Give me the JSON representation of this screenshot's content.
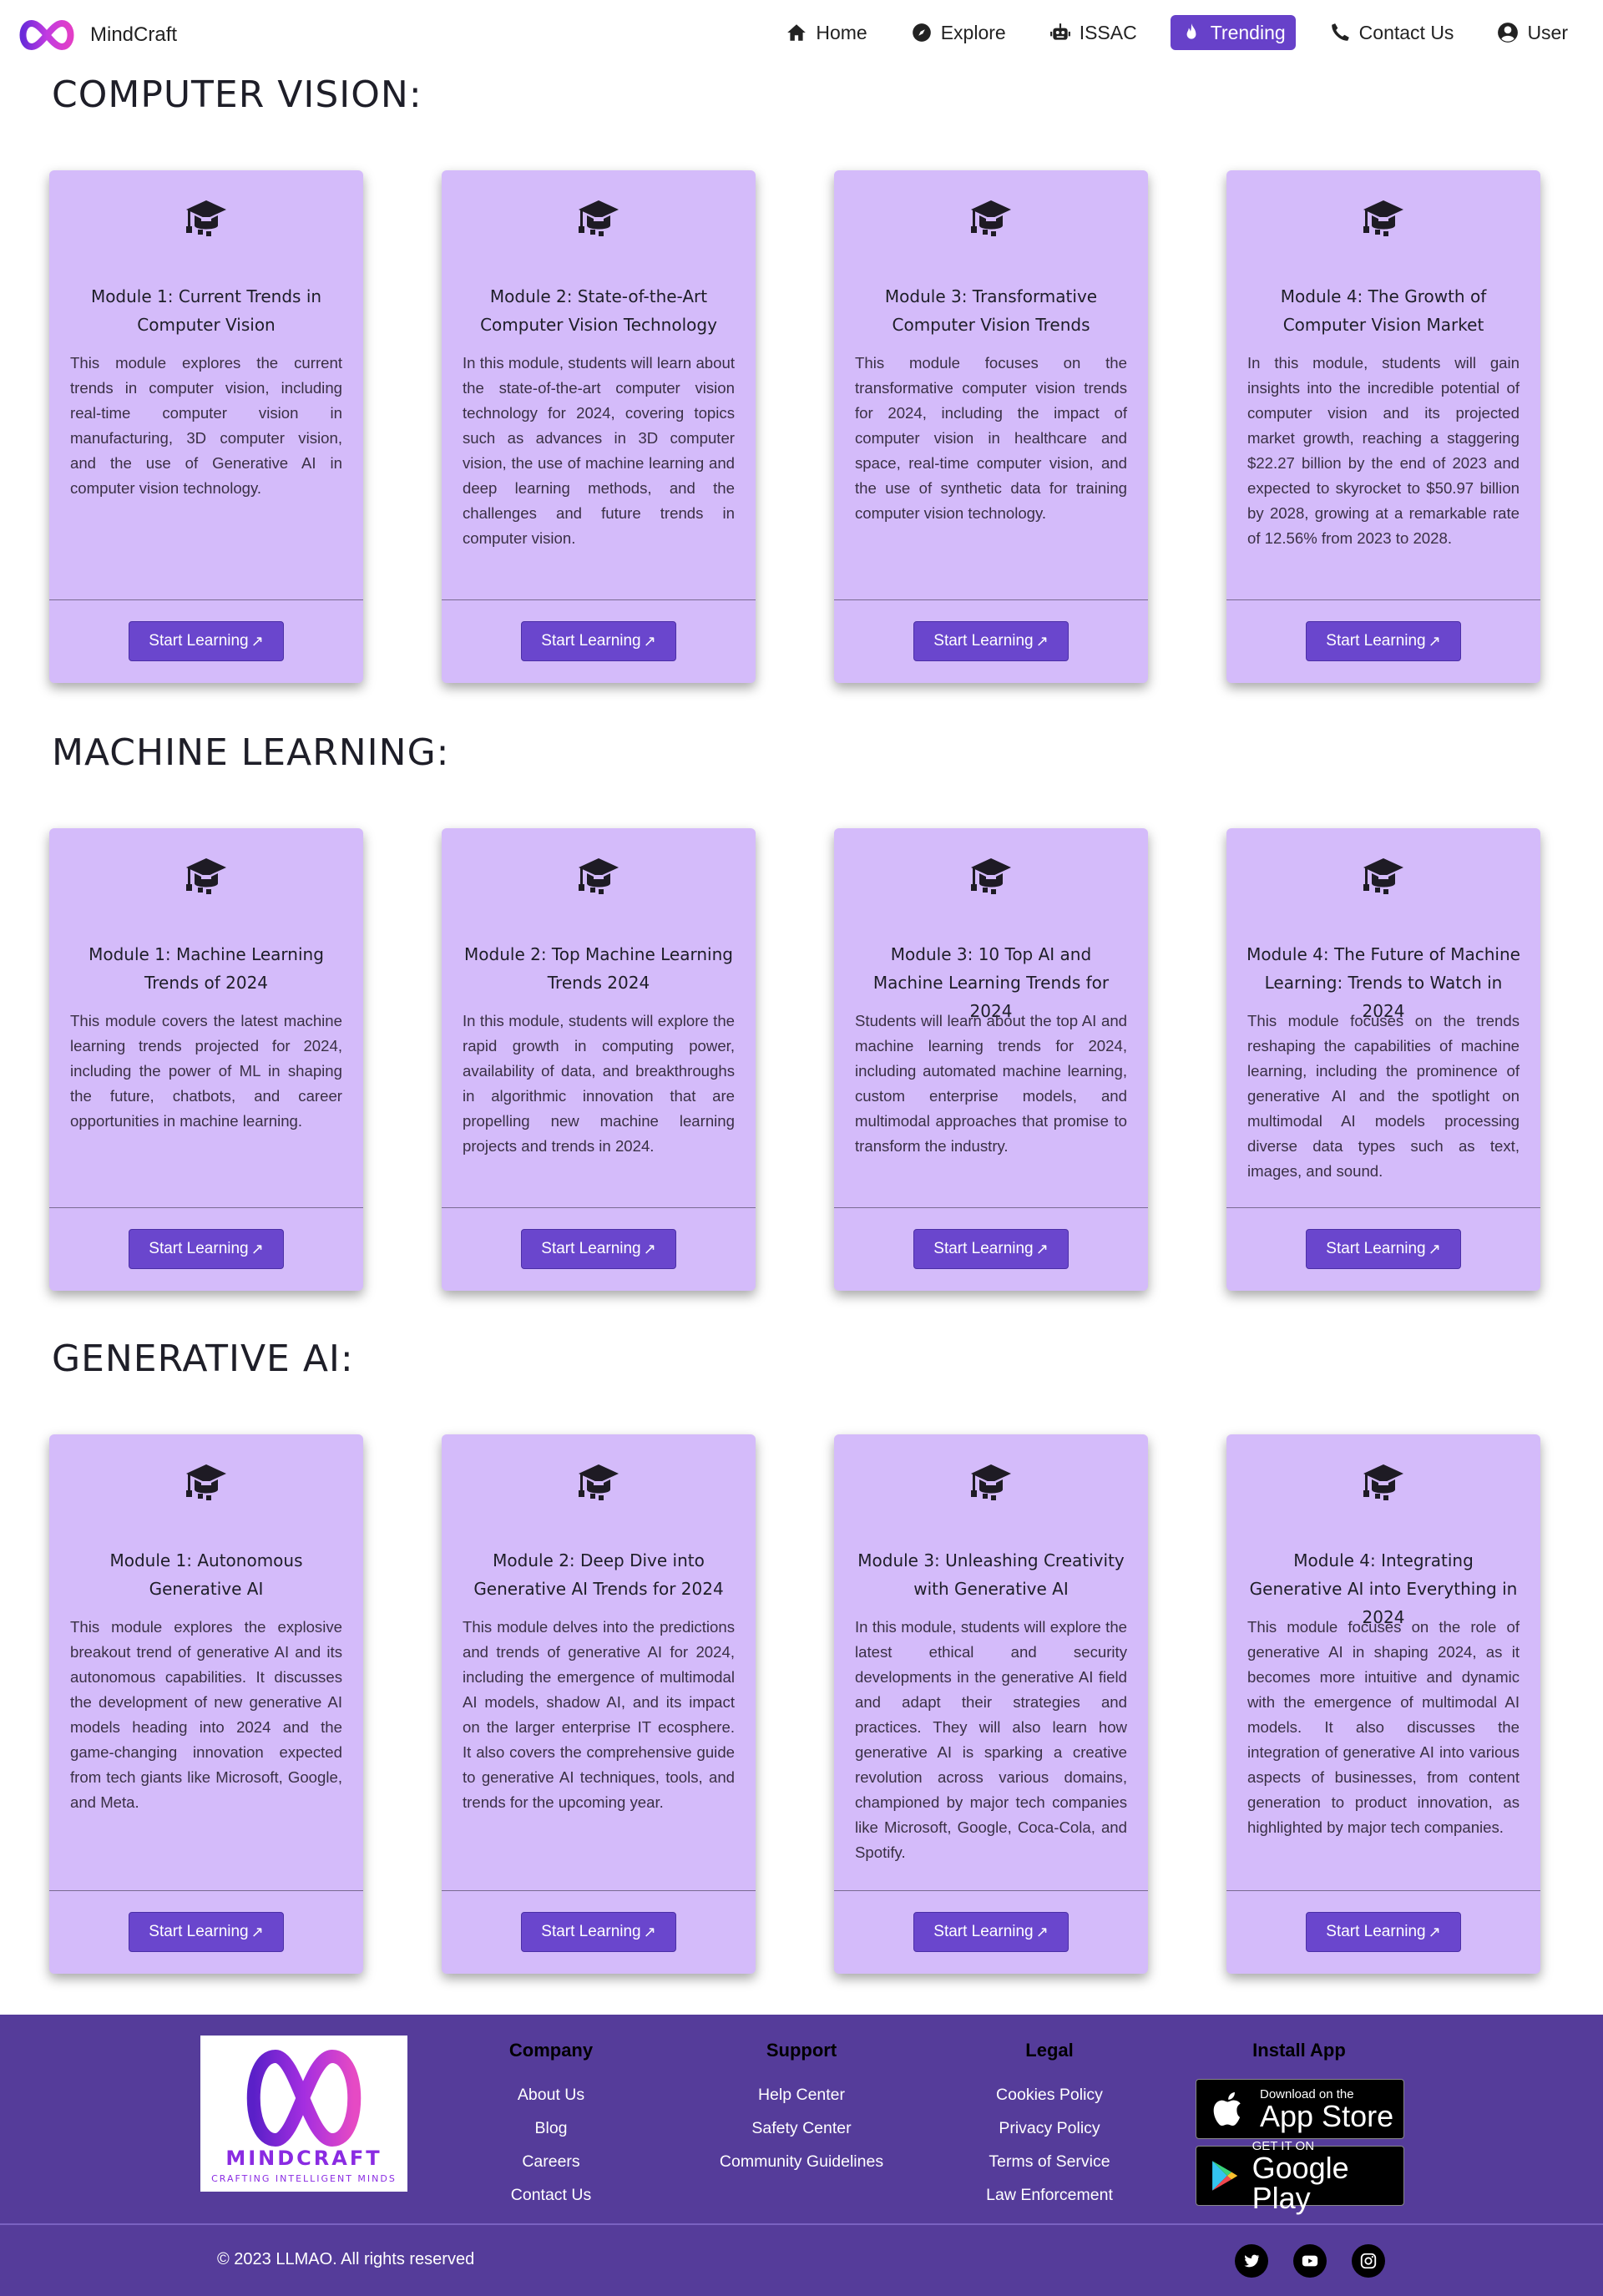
{
  "brand": {
    "name": "MindCraft",
    "logo_icon": "infinity-logo"
  },
  "nav": {
    "items": [
      {
        "label": "Home",
        "icon": "home-icon"
      },
      {
        "label": "Explore",
        "icon": "compass-icon"
      },
      {
        "label": "ISSAC",
        "icon": "robot-icon"
      },
      {
        "label": "Trending",
        "icon": "fire-icon",
        "active": true
      },
      {
        "label": "Contact Us",
        "icon": "phone-icon"
      },
      {
        "label": "User",
        "icon": "user-icon"
      }
    ]
  },
  "button_label": "Start Learning",
  "sections": [
    {
      "title": "COMPUTER VISION:",
      "cards": [
        {
          "title": "Module 1: Current Trends in Computer Vision",
          "text": "This module explores the current trends in computer vision, including real-time computer vision in manufacturing, 3D computer vision, and the use of Generative AI in computer vision technology."
        },
        {
          "title": "Module 2: State-of-the-Art Computer Vision Technology",
          "text": "In this module, students will learn about the state-of-the-art computer vision technology for 2024, covering topics such as advances in 3D computer vision, the use of machine learning and deep learning methods, and the challenges and future trends in computer vision."
        },
        {
          "title": "Module 3: Transformative Computer Vision Trends",
          "text": "This module focuses on the transformative computer vision trends for 2024, including the impact of computer vision in healthcare and space, real-time computer vision, and the use of synthetic data for training computer vision technology."
        },
        {
          "title": "Module 4: The Growth of Computer Vision Market",
          "text": "In this module, students will gain insights into the incredible potential of computer vision and its projected market growth, reaching a staggering $22.27 billion by the end of 2023 and expected to skyrocket to $50.97 billion by 2028, growing at a remarkable rate of 12.56% from 2023 to 2028."
        }
      ]
    },
    {
      "title": "MACHINE LEARNING:",
      "cards": [
        {
          "title": "Module 1: Machine Learning Trends of 2024",
          "text": "This module covers the latest machine learning trends projected for 2024, including the power of ML in shaping the future, chatbots, and career opportunities in machine learning."
        },
        {
          "title": "Module 2: Top Machine Learning Trends 2024",
          "text": "In this module, students will explore the rapid growth in computing power, availability of data, and breakthroughs in algorithmic innovation that are propelling new machine learning projects and trends in 2024."
        },
        {
          "title": "Module 3: 10 Top AI and Machine Learning Trends for 2024",
          "text": "Students will learn about the top AI and machine learning trends for 2024, including automated machine learning, custom enterprise models, and multimodal approaches that promise to transform the industry."
        },
        {
          "title": "Module 4: The Future of Machine Learning: Trends to Watch in 2024",
          "text": "This module focuses on the trends reshaping the capabilities of machine learning, including the prominence of generative AI and the spotlight on multimodal AI models processing diverse data types such as text, images, and sound."
        }
      ]
    },
    {
      "title": "GENERATIVE AI:",
      "cards": [
        {
          "title": "Module 1: Autonomous Generative AI",
          "text": "This module explores the explosive breakout trend of generative AI and its autonomous capabilities. It discusses the development of new generative AI models heading into 2024 and the game-changing innovation expected from tech giants like Microsoft, Google, and Meta."
        },
        {
          "title": "Module 2: Deep Dive into Generative AI Trends for 2024",
          "text": "This module delves into the predictions and trends of generative AI for 2024, including the emergence of multimodal AI models, shadow AI, and its impact on the larger enterprise IT ecosphere. It also covers the comprehensive guide to generative AI techniques, tools, and trends for the upcoming year."
        },
        {
          "title": "Module 3: Unleashing Creativity with Generative AI",
          "text": "In this module, students will explore the latest ethical and security developments in the generative AI field and adapt their strategies and practices. They will also learn how generative AI is sparking a creative revolution across various domains, championed by major tech companies like Microsoft, Google, Coca-Cola, and Spotify."
        },
        {
          "title": "Module 4: Integrating Generative AI into Everything in 2024",
          "text": "This module focuses on the role of generative AI in shaping 2024, as it becomes more intuitive and dynamic with the emergence of multimodal AI models. It also discusses the integration of generative AI into various aspects of businesses, from content generation to product innovation, as highlighted by major tech companies."
        }
      ]
    }
  ],
  "footer": {
    "logo_word": "MINDCRAFT",
    "logo_tagline": "CRAFTING INTELLIGENT MINDS",
    "columns": [
      {
        "heading": "Company",
        "links": [
          "About Us",
          "Blog",
          "Careers",
          "Contact Us"
        ]
      },
      {
        "heading": "Support",
        "links": [
          "Help Center",
          "Safety Center",
          "Community Guidelines"
        ]
      },
      {
        "heading": "Legal",
        "links": [
          "Cookies Policy",
          "Privacy Policy",
          "Terms of Service",
          "Law Enforcement"
        ]
      }
    ],
    "install": {
      "heading": "Install App",
      "app_store": {
        "small": "Download on the",
        "big": "App Store"
      },
      "google_play": {
        "small": "GET IT ON",
        "big": "Google Play"
      }
    },
    "copyright": "© 2023 LLMAO. All rights reserved",
    "social": [
      "twitter-icon",
      "youtube-icon",
      "instagram-icon"
    ]
  },
  "colors": {
    "accent": "#6741c9",
    "card_bg": "#d4bbfa",
    "footer_bg": "#553c9a",
    "button_bg": "#6a46cd"
  }
}
